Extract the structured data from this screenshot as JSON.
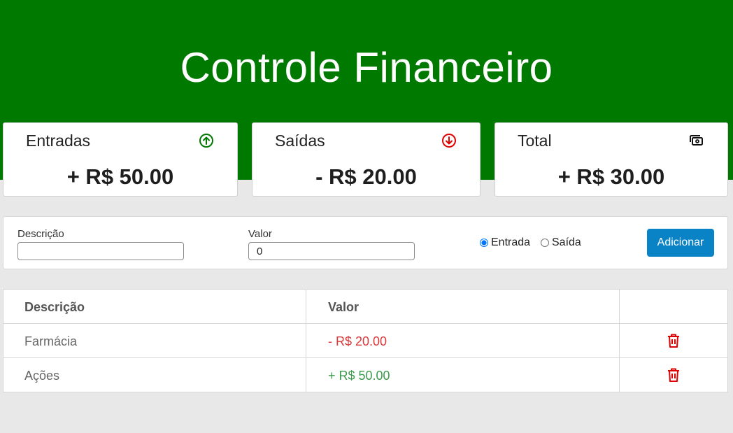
{
  "header": {
    "title": "Controle Financeiro"
  },
  "summary": {
    "entradas": {
      "label": "Entradas",
      "value": "+ R$ 50.00",
      "icon": "arrow-up-circle-icon",
      "icon_color": "#007900"
    },
    "saidas": {
      "label": "Saídas",
      "value": "- R$ 20.00",
      "icon": "arrow-down-circle-icon",
      "icon_color": "#e00000"
    },
    "total": {
      "label": "Total",
      "value": "+ R$ 30.00",
      "icon": "cash-icon",
      "icon_color": "#111111"
    }
  },
  "form": {
    "descricao_label": "Descrição",
    "descricao_value": "",
    "valor_label": "Valor",
    "valor_value": "0",
    "radio_entrada": "Entrada",
    "radio_saida": "Saída",
    "selected": "Entrada",
    "add_button": "Adicionar"
  },
  "table": {
    "headers": [
      "Descrição",
      "Valor",
      ""
    ],
    "rows": [
      {
        "descricao": "Farmácia",
        "valor": "- R$ 20.00",
        "type": "saida"
      },
      {
        "descricao": "Ações",
        "valor": "+ R$ 50.00",
        "type": "entrada"
      }
    ]
  },
  "colors": {
    "header_bg": "#007900",
    "primary_button": "#0a82c6",
    "negative": "#d83a3a",
    "positive": "#3c9a4c",
    "delete_icon": "#e00000"
  }
}
